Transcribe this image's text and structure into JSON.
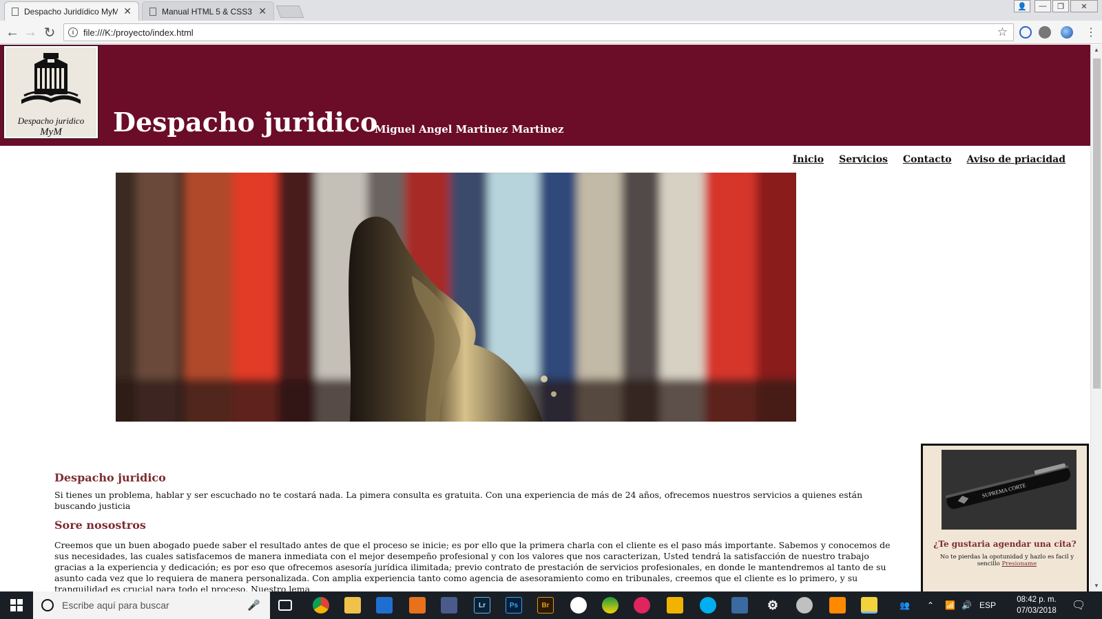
{
  "browser": {
    "tabs": [
      {
        "title": "Despacho Juridídico MyM",
        "active": true
      },
      {
        "title": "Manual HTML 5 & CSS3",
        "active": false
      }
    ],
    "url": "file:///K:/proyecto/index.html"
  },
  "site": {
    "logo_line1": "Despacho juridico",
    "logo_line2": "MyM",
    "title": "Despacho juridico",
    "subtitle": "Miguel Angel Martinez Martinez",
    "header_color": "#6b0c29"
  },
  "nav": {
    "items": [
      "Inicio",
      "Servicios",
      "Contacto",
      "Aviso de priacidad"
    ]
  },
  "main": {
    "section1_heading": "Despacho juridico",
    "section1_text": "Si tienes un problema, hablar y ser escuchado no te costará nada. La pimera consulta es gratuita. Con una experiencia de más de 24 años, ofrecemos nuestros servicios a quienes están buscando justicia",
    "section2_heading": "Sore nosostros",
    "section2_text": "Creemos que un buen abogado puede saber el resultado antes de que el proceso se inicie; es por ello que la primera charla con el cliente es el paso más importante. Sabemos y conocemos de sus necesidades, las cuales satisfacemos de manera inmediata con el mejor desempeño profesional y con los valores que nos caracterizan, Usted tendrá la satisfacción de nuestro trabajo gracias a la experiencia y dedicación; es por eso que ofrecemos asesoría jurídica ilimitada; previo contrato de prestación de servicios profesionales, en donde le mantendremos al tanto de su asunto cada vez que lo requiera de manera personalizada. Con amplia experiencia tanto como agencia de asesoramiento como en tribunales, creemos que el cliente es lo primero, y su tranquilidad es crucial para todo el proceso. Nuestro lema",
    "accent_color": "#7d2b32"
  },
  "aside": {
    "pen_text": "SUPREMA CORTE",
    "cta": "¿Te gustaria agendar una cita?",
    "small_text": "No te pierdas la opotunidad y hazlo es facil y sencillo",
    "link": "Presioname"
  },
  "taskbar": {
    "search_placeholder": "Escribe aquí para buscar",
    "language": "ESP",
    "time": "08:42 p. m.",
    "date": "07/03/2018",
    "apps": [
      "Lr",
      "Ps",
      "Br"
    ]
  }
}
